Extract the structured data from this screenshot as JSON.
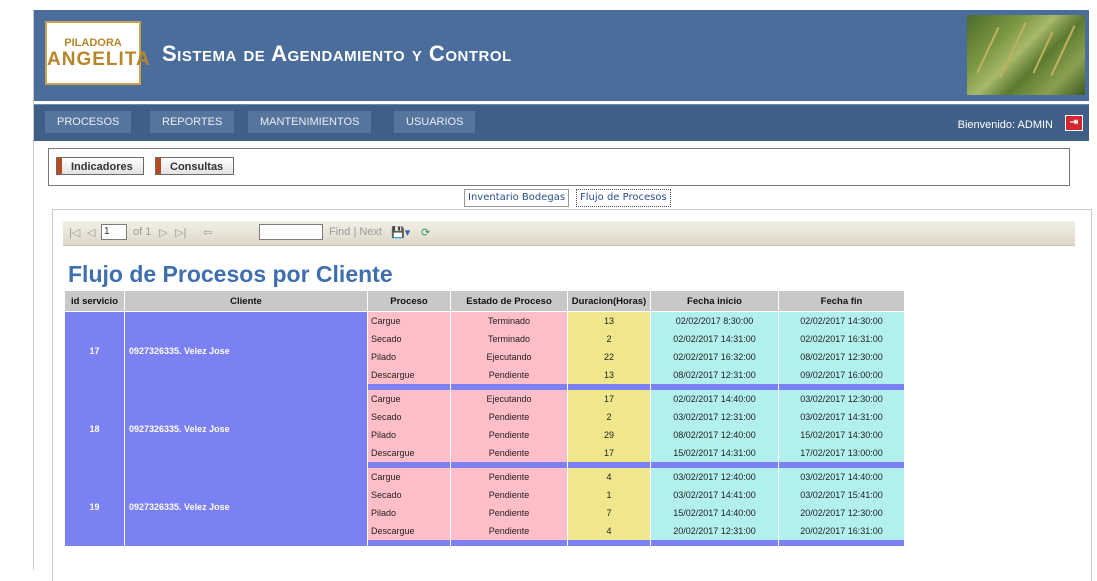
{
  "header": {
    "logo_line1": "PILADORA",
    "logo_line2": "ANGELITA",
    "title": "Sistema de Agendamiento y Control"
  },
  "nav": {
    "items": [
      "PROCESOS",
      "REPORTES",
      "MANTENIMIENTOS",
      "USUARIOS"
    ],
    "welcome": "Bienvenido: ADMIN"
  },
  "subtabs": [
    "Indicadores",
    "Consultas"
  ],
  "report_tabs": [
    "Inventario Bodegas",
    "Flujo de Procesos"
  ],
  "toolbar": {
    "page_value": "1",
    "of_pages": "of 1",
    "find_next": "Find | Next"
  },
  "report": {
    "title": "Flujo de Procesos por Cliente",
    "columns": [
      "id servicio",
      "Cliente",
      "Proceso",
      "Estado de Proceso",
      "Duracion(Horas)",
      "Fecha inicio",
      "Fecha fin"
    ],
    "groups": [
      {
        "id": "17",
        "cliente": "0927326335. Velez Jose",
        "rows": [
          {
            "proceso": "Cargue",
            "estado": "Terminado",
            "duracion": "13",
            "inicio": "02/02/2017 8:30:00",
            "fin": "02/02/2017 14:30:00"
          },
          {
            "proceso": "Secado",
            "estado": "Terminado",
            "duracion": "2",
            "inicio": "02/02/2017 14:31:00",
            "fin": "02/02/2017 16:31:00"
          },
          {
            "proceso": "Pilado",
            "estado": "Ejecutando",
            "duracion": "22",
            "inicio": "02/02/2017 16:32:00",
            "fin": "08/02/2017 12:30:00"
          },
          {
            "proceso": "Descargue",
            "estado": "Pendiente",
            "duracion": "13",
            "inicio": "08/02/2017 12:31:00",
            "fin": "09/02/2017 16:00:00"
          }
        ]
      },
      {
        "id": "18",
        "cliente": "0927326335. Velez Jose",
        "rows": [
          {
            "proceso": "Cargue",
            "estado": "Ejecutando",
            "duracion": "17",
            "inicio": "02/02/2017 14:40:00",
            "fin": "03/02/2017 12:30:00"
          },
          {
            "proceso": "Secado",
            "estado": "Pendiente",
            "duracion": "2",
            "inicio": "03/02/2017 12:31:00",
            "fin": "03/02/2017 14:31:00"
          },
          {
            "proceso": "Pilado",
            "estado": "Pendiente",
            "duracion": "29",
            "inicio": "08/02/2017 12:40:00",
            "fin": "15/02/2017 14:30:00"
          },
          {
            "proceso": "Descargue",
            "estado": "Pendiente",
            "duracion": "17",
            "inicio": "15/02/2017 14:31:00",
            "fin": "17/02/2017 13:00:00"
          }
        ]
      },
      {
        "id": "19",
        "cliente": "0927326335. Velez Jose",
        "rows": [
          {
            "proceso": "Cargue",
            "estado": "Pendiente",
            "duracion": "4",
            "inicio": "03/02/2017 12:40:00",
            "fin": "03/02/2017 14:40:00"
          },
          {
            "proceso": "Secado",
            "estado": "Pendiente",
            "duracion": "1",
            "inicio": "03/02/2017 14:41:00",
            "fin": "03/02/2017 15:41:00"
          },
          {
            "proceso": "Pilado",
            "estado": "Pendiente",
            "duracion": "7",
            "inicio": "15/02/2017 14:40:00",
            "fin": "20/02/2017 12:30:00"
          },
          {
            "proceso": "Descargue",
            "estado": "Pendiente",
            "duracion": "4",
            "inicio": "20/02/2017 12:31:00",
            "fin": "20/02/2017 16:31:00"
          }
        ]
      }
    ]
  },
  "colors": {
    "header_bg": "#4a6d9c",
    "nav_bg": "#3f5f86",
    "group_bg": "#7b80f2",
    "proceso_bg": "#ffbec8",
    "duracion_bg": "#f0e68c",
    "fecha_bg": "#b2f0ee",
    "title_color": "#3f6fae"
  }
}
